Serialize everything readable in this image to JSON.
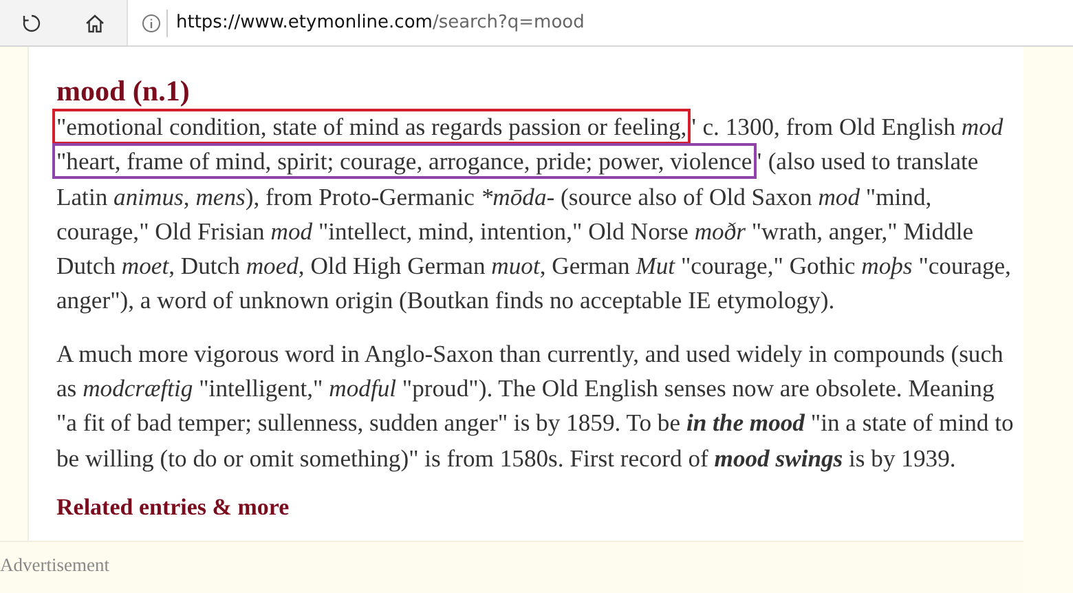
{
  "browser": {
    "url_host": "https://www.etymonline.com",
    "url_path": "/search?q=mood"
  },
  "entry": {
    "title": "mood (n.1)",
    "paragraphs": [
      {
        "segments": [
          {
            "kind": "highlight",
            "text": "\"emotional condition, state of mind as regards passion or feeling,",
            "color": "#d4202c"
          },
          {
            "kind": "plain",
            "text": "\" c. 1300, from Old English"
          },
          {
            "kind": "italic",
            "text": "mod"
          },
          {
            "kind": "highlight",
            "text": "\"heart, frame of mind, spirit; courage, arrogance, pride; power, violence",
            "color": "#8e44a8"
          },
          {
            "kind": "plain",
            "text": "\" (also used to translate Latin"
          },
          {
            "kind": "italic",
            "text": "animus"
          },
          {
            "kind": "plain",
            "text": ", "
          },
          {
            "kind": "italic",
            "text": "mens"
          },
          {
            "kind": "plain",
            "text": "), from Proto-Germanic"
          },
          {
            "kind": "italic",
            "text": "*mōda-"
          },
          {
            "kind": "plain",
            "text": "(source also of Old Saxon"
          },
          {
            "kind": "italic",
            "text": "mod"
          },
          {
            "kind": "plain",
            "text": "\"mind, courage,\" Old Frisian"
          },
          {
            "kind": "italic",
            "text": "mod"
          },
          {
            "kind": "plain",
            "text": "\"intellect, mind, intention,\" Old Norse"
          },
          {
            "kind": "italic",
            "text": "moðr"
          },
          {
            "kind": "plain",
            "text": "\"wrath, anger,\" Middle Dutch"
          },
          {
            "kind": "italic",
            "text": "moet"
          },
          {
            "kind": "plain",
            "text": ", Dutch "
          },
          {
            "kind": "italic",
            "text": "moed"
          },
          {
            "kind": "plain",
            "text": ", Old High German"
          },
          {
            "kind": "italic",
            "text": "muot"
          },
          {
            "kind": "plain",
            "text": ", German"
          },
          {
            "kind": "italic",
            "text": "Mut"
          },
          {
            "kind": "plain",
            "text": "\"courage,\" Gothic"
          },
          {
            "kind": "italic",
            "text": "moþs"
          },
          {
            "kind": "plain",
            "text": "\"courage, anger\"), a word of unknown origin (Boutkan finds no acceptable IE etymology)."
          }
        ]
      },
      {
        "segments": [
          {
            "kind": "plain",
            "text": "A much more vigorous word in Anglo-Saxon than currently, and used widely in compounds (such as"
          },
          {
            "kind": "italic",
            "text": "modcræftig"
          },
          {
            "kind": "plain",
            "text": "\"intelligent,\""
          },
          {
            "kind": "italic",
            "text": "modful"
          },
          {
            "kind": "plain",
            "text": "\"proud\"). The Old English senses now are obsolete. Meaning \"a fit of bad temper; sullenness, sudden anger\" is by 1859. To be"
          },
          {
            "kind": "bold-italic",
            "text": "in the mood"
          },
          {
            "kind": "plain",
            "text": "\"in a state of mind to be willing (to do or omit something)\" is from 1580s. First record of"
          },
          {
            "kind": "bold-italic",
            "text": "mood swings"
          },
          {
            "kind": "plain",
            "text": "is by 1939."
          }
        ]
      }
    ],
    "related_link": "Related entries & more"
  },
  "advertisement": "Advertisement"
}
